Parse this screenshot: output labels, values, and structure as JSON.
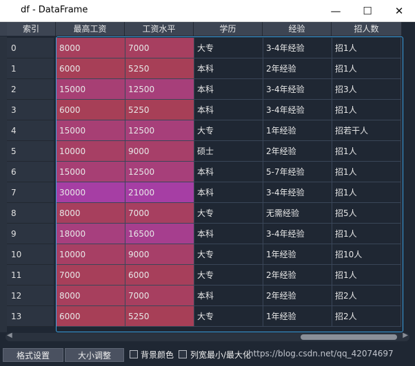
{
  "window": {
    "title": "df - DataFrame",
    "minimize": "—",
    "maximize": "☐",
    "close": "✕"
  },
  "columns": [
    "索引",
    "最高工资",
    "工资水平",
    "学历",
    "经验",
    "招人数"
  ],
  "rows": [
    {
      "idx": "0",
      "max": "8000",
      "level": "7000",
      "edu": "大专",
      "exp": "3-4年经验",
      "hire": "招1人"
    },
    {
      "idx": "1",
      "max": "6000",
      "level": "5250",
      "edu": "本科",
      "exp": "2年经验",
      "hire": "招1人"
    },
    {
      "idx": "2",
      "max": "15000",
      "level": "12500",
      "edu": "本科",
      "exp": "3-4年经验",
      "hire": "招3人"
    },
    {
      "idx": "3",
      "max": "6000",
      "level": "5250",
      "edu": "本科",
      "exp": "3-4年经验",
      "hire": "招1人"
    },
    {
      "idx": "4",
      "max": "15000",
      "level": "12500",
      "edu": "大专",
      "exp": "1年经验",
      "hire": "招若干人"
    },
    {
      "idx": "5",
      "max": "10000",
      "level": "9000",
      "edu": "硕士",
      "exp": "2年经验",
      "hire": "招1人"
    },
    {
      "idx": "6",
      "max": "15000",
      "level": "12500",
      "edu": "本科",
      "exp": "5-7年经验",
      "hire": "招1人"
    },
    {
      "idx": "7",
      "max": "30000",
      "level": "21000",
      "edu": "本科",
      "exp": "3-4年经验",
      "hire": "招1人"
    },
    {
      "idx": "8",
      "max": "8000",
      "level": "7000",
      "edu": "大专",
      "exp": "无需经验",
      "hire": "招5人"
    },
    {
      "idx": "9",
      "max": "18000",
      "level": "16500",
      "edu": "本科",
      "exp": "3-4年经验",
      "hire": "招1人"
    },
    {
      "idx": "10",
      "max": "10000",
      "level": "9000",
      "edu": "大专",
      "exp": "1年经验",
      "hire": "招10人"
    },
    {
      "idx": "11",
      "max": "7000",
      "level": "6000",
      "edu": "大专",
      "exp": "2年经验",
      "hire": "招1人"
    },
    {
      "idx": "12",
      "max": "8000",
      "level": "7000",
      "edu": "本科",
      "exp": "2年经验",
      "hire": "招2人"
    },
    {
      "idx": "13",
      "max": "6000",
      "level": "5250",
      "edu": "大专",
      "exp": "1年经验",
      "hire": "招2人"
    }
  ],
  "bottom": {
    "format_button": "格式设置",
    "resize_button": "大小调整",
    "bg_color_label": "背景颜色",
    "col_width_label": "列宽最小/最大化",
    "watermark": "https://blog.csdn.net/qq_42074697"
  },
  "colors": {
    "accent": "#3ba0e0",
    "low": "#a73f57",
    "high": "#a63ea4"
  }
}
